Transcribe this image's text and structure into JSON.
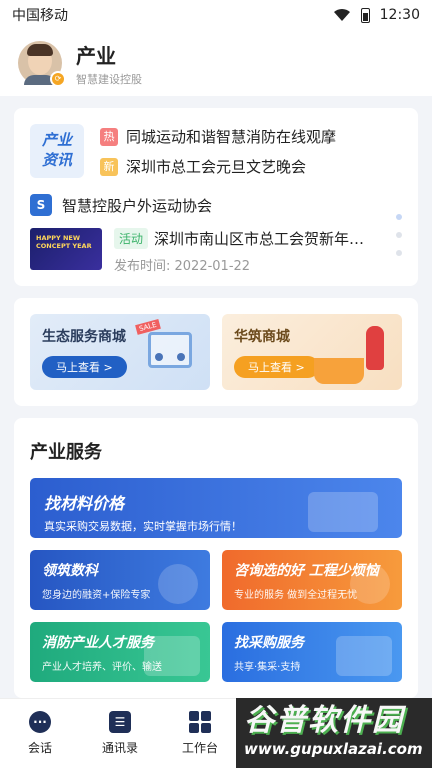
{
  "status_bar": {
    "carrier": "中国移动",
    "time": "12:30"
  },
  "header": {
    "title": "产业",
    "subtitle": "智慧建设控股"
  },
  "news": {
    "logo": [
      "产业",
      "资讯"
    ],
    "hot_items": [
      {
        "tag": "热",
        "title": "同城运动和谐智慧消防在线观摩"
      },
      {
        "tag": "新",
        "title": "深圳市总工会元旦文艺晚会"
      }
    ],
    "association": {
      "icon": "S",
      "name": "智慧控股户外运动协会"
    },
    "featured": {
      "thumb_text": "HAPPY NEW CONCEPT YEAR",
      "tag": "活动",
      "title": "深圳市南山区市总工会贺新年…",
      "date": "发布时间: 2022-01-22"
    }
  },
  "malls": [
    {
      "name": "生态服务商城",
      "button": "马上查看 >",
      "badge": "SALE"
    },
    {
      "name": "华筑商城",
      "button": "马上查看 >"
    }
  ],
  "services": {
    "title": "产业服务",
    "banner": {
      "title": "找材料价格",
      "subtitle": "真实采购交易数据，实时掌握市场行情！"
    },
    "tiles": [
      {
        "title": "领筑数科",
        "subtitle": "您身边的融资+保险专家"
      },
      {
        "title": "咨询选的好 工程少烦恼",
        "subtitle": "专业的服务 做到全过程无忧"
      },
      {
        "title": "消防产业人才服务",
        "subtitle": "产业人才培养、评价、输送"
      },
      {
        "title": "找采购服务",
        "subtitle": "共享·集采·支持"
      }
    ]
  },
  "tabbar": [
    {
      "label": "会话",
      "icon": "chat-icon"
    },
    {
      "label": "通讯录",
      "icon": "contacts-icon"
    },
    {
      "label": "工作台",
      "icon": "workbench-icon"
    }
  ],
  "watermark": {
    "title": "谷普软件园",
    "url": "www.gupuxlazai.com"
  }
}
